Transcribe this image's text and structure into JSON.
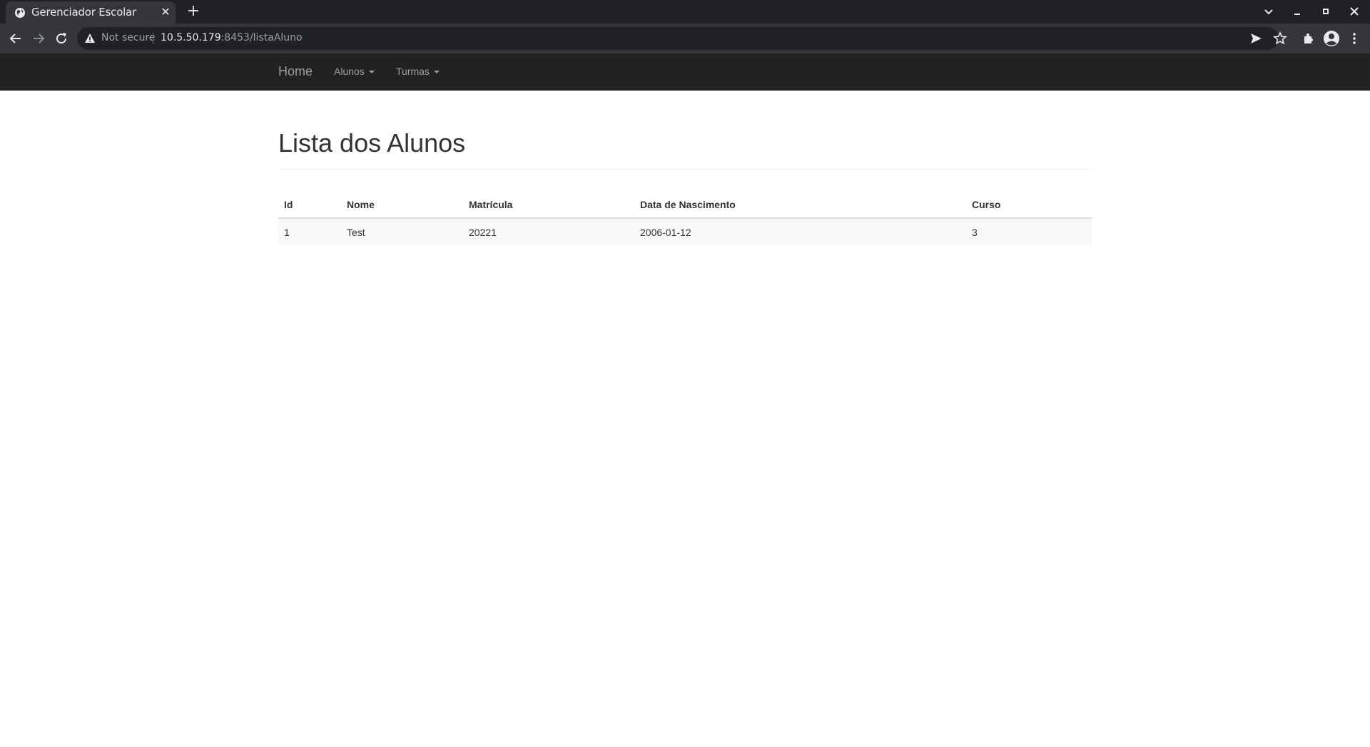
{
  "browser": {
    "tab_title": "Gerenciador Escolar",
    "tab_close": "✕",
    "new_tab": "+",
    "security_label": "Not secure",
    "url_host": "10.5.50.179",
    "url_rest": ":8453/listaAluno"
  },
  "navbar": {
    "brand": "Home",
    "items": [
      {
        "label": "Alunos"
      },
      {
        "label": "Turmas"
      }
    ]
  },
  "page": {
    "title": "Lista dos Alunos"
  },
  "table": {
    "headers": [
      "Id",
      "Nome",
      "Matrícula",
      "Data de Nascimento",
      "Curso"
    ],
    "rows": [
      [
        "1",
        "Test",
        "20221",
        "2006-01-12",
        "3"
      ]
    ]
  },
  "colors": {
    "navbar_bg": "#222222",
    "nav_text": "#9d9d9d",
    "chrome_bg": "#35363a"
  }
}
